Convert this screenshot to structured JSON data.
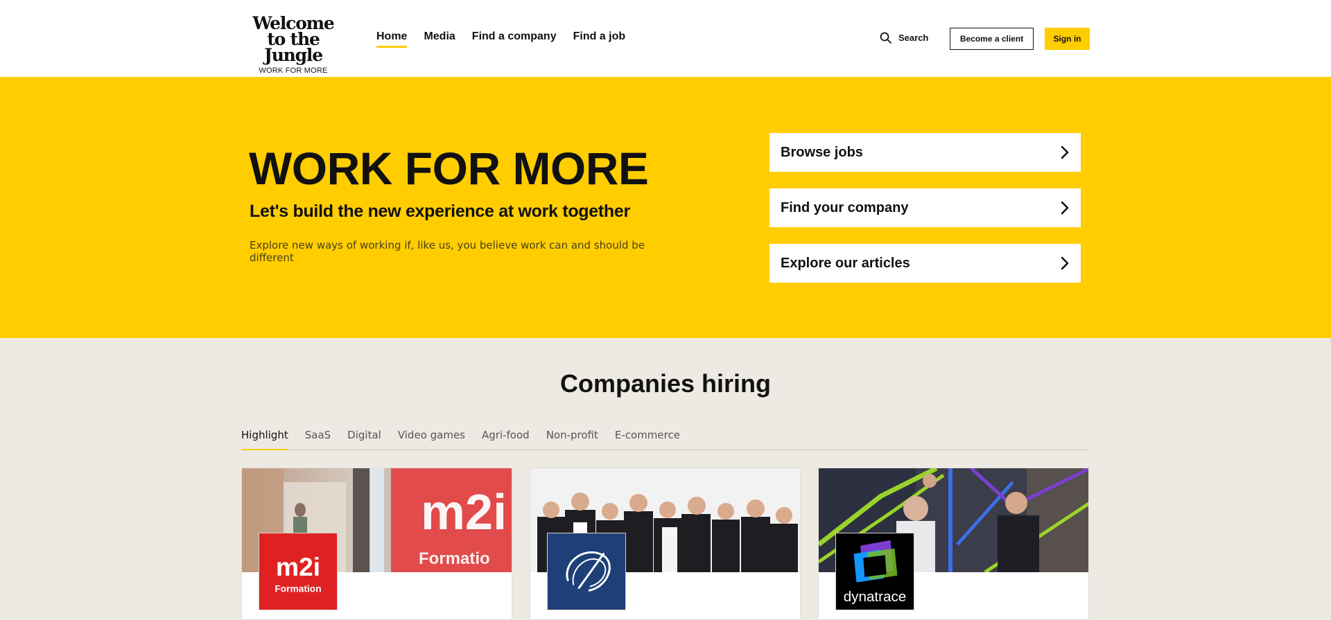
{
  "header": {
    "logo": {
      "line1": "Welcome",
      "line2": "to the Jungle",
      "tagline": "WORK FOR MORE"
    },
    "nav": [
      {
        "label": "Home",
        "active": true
      },
      {
        "label": "Media"
      },
      {
        "label": "Find a company"
      },
      {
        "label": "Find a job"
      }
    ],
    "search_label": "Search",
    "become_client_label": "Become a client",
    "sign_in_label": "Sign in"
  },
  "hero": {
    "title": "WORK FOR MORE",
    "subtitle": "Let's build the new experience at work together",
    "description": "Explore new ways of working if, like us, you believe work can and should be different",
    "cta": [
      {
        "label": "Browse jobs",
        "icon": "chevron-right-icon"
      },
      {
        "label": "Find your company",
        "icon": "chevron-right-icon"
      },
      {
        "label": "Explore our articles",
        "icon": "chevron-right-icon"
      }
    ]
  },
  "companies": {
    "title": "Companies hiring",
    "tabs": [
      {
        "label": "Highlight",
        "active": true
      },
      {
        "label": "SaaS"
      },
      {
        "label": "Digital"
      },
      {
        "label": "Video games"
      },
      {
        "label": "Agri-food"
      },
      {
        "label": "Non-profit"
      },
      {
        "label": "E-commerce"
      }
    ],
    "cards": [
      {
        "logo_text": "m2i",
        "logo_subtext": "Formation",
        "cover_text": "m2i",
        "cover_subtext": "Formatio"
      },
      {
        "logo_text": ""
      },
      {
        "logo_text": "dynatrace"
      }
    ]
  },
  "colors": {
    "brand_yellow": "#ffcd00",
    "section_bg": "#ede9e3",
    "m2i_red": "#e02121",
    "card2_logo_blue": "#1f3f78",
    "dynatrace_bg": "#000000"
  }
}
